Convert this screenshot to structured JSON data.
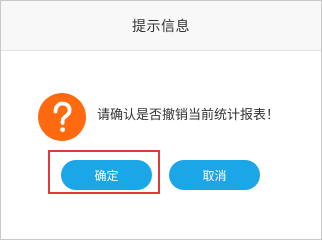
{
  "dialog": {
    "title": "提示信息",
    "icon": "question-icon",
    "icon_color": "#ff6a10",
    "message": "请确认是否撤销当前统计报表！",
    "confirm_label": "确定",
    "cancel_label": "取消",
    "button_color": "#1ba6e8",
    "highlight_color": "#e03a3a"
  }
}
